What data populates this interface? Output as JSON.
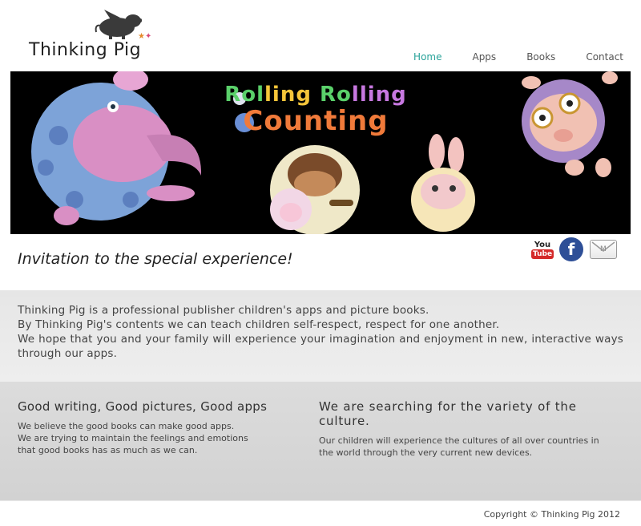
{
  "header": {
    "logo_text": "Thinking Pig",
    "nav": [
      {
        "label": "Home",
        "active": true
      },
      {
        "label": "Apps",
        "active": false
      },
      {
        "label": "Books",
        "active": false
      },
      {
        "label": "Contact",
        "active": false
      }
    ]
  },
  "banner": {
    "title_line1": "Rolling Rolling",
    "title_line2": "Counting"
  },
  "social": {
    "youtube_label": "You Tube",
    "icons": [
      "youtube-icon",
      "facebook-icon",
      "mail-icon"
    ]
  },
  "tagline": "Invitation to the special experience!",
  "intro": {
    "line1": "Thinking Pig is a professional publisher children's apps and picture books.",
    "line2": "By Thinking Pig's contents we can teach children self-respect, respect for one another.",
    "line3": "We hope that you and your family will experience your imagination and enjoyment in new, interactive ways through our apps."
  },
  "features": {
    "left": {
      "heading": "Good writing, Good pictures, Good apps",
      "line1": "We believe the good books can make good apps.",
      "line2": "We are trying to maintain the feelings and emotions",
      "line3": "that good books has as much as we can."
    },
    "right": {
      "heading": "We are searching for the variety of the culture.",
      "line1": "Our children will experience the cultures of all over countries in",
      "line2": "the world through the very current new devices."
    }
  },
  "footer": {
    "copyright": "Copyright © Thinking Pig 2012"
  },
  "colors": {
    "nav_active": "#2aa39a",
    "intro_bg": "#e9e9e9",
    "features_bg": "#d6d6d6"
  }
}
